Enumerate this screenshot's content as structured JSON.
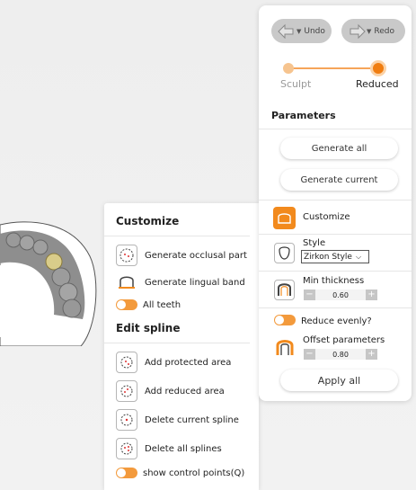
{
  "toolbar": {
    "undo_label": "Undo",
    "redo_label": "Redo",
    "caret": "▼"
  },
  "stage_slider": {
    "left_label": "Sculpt",
    "right_label": "Reduced",
    "selected": "Reduced"
  },
  "parameters": {
    "heading": "Parameters",
    "generate_all_label": "Generate all",
    "generate_current_label": "Generate current",
    "customize_label": "Customize",
    "style_label": "Style",
    "style_value": "Zirkon Style",
    "min_thickness_label": "Min thickness",
    "min_thickness_value": "0.60",
    "reduce_evenly_label": "Reduce evenly?",
    "reduce_evenly_on": true,
    "offset_label": "Offset parameters",
    "offset_value": "0.80",
    "apply_all_label": "Apply all",
    "minus": "−",
    "plus": "+"
  },
  "customize_panel": {
    "heading": "Customize",
    "generate_occlusal_label": "Generate occlusal part",
    "generate_lingual_label": "Generate lingual band",
    "all_teeth_label": "All teeth",
    "all_teeth_on": true,
    "edit_spline_heading": "Edit spline",
    "add_protected_label": "Add protected area",
    "add_reduced_label": "Add reduced area",
    "delete_current_label": "Delete current spline",
    "delete_all_label": "Delete all splines",
    "show_control_points_label": "show control points(Q)",
    "show_control_points_on": true
  },
  "colors": {
    "accent": "#f28a1d",
    "toggle_on": "#f39a3c",
    "button_gray": "#c9c9c9"
  },
  "icons": {
    "undo": "undo-arrow-icon",
    "redo": "redo-arrow-icon",
    "customize": "crown-outline-icon",
    "style": "tooth-icon",
    "min_thickness": "thickness-icon",
    "offset": "offset-icon"
  }
}
